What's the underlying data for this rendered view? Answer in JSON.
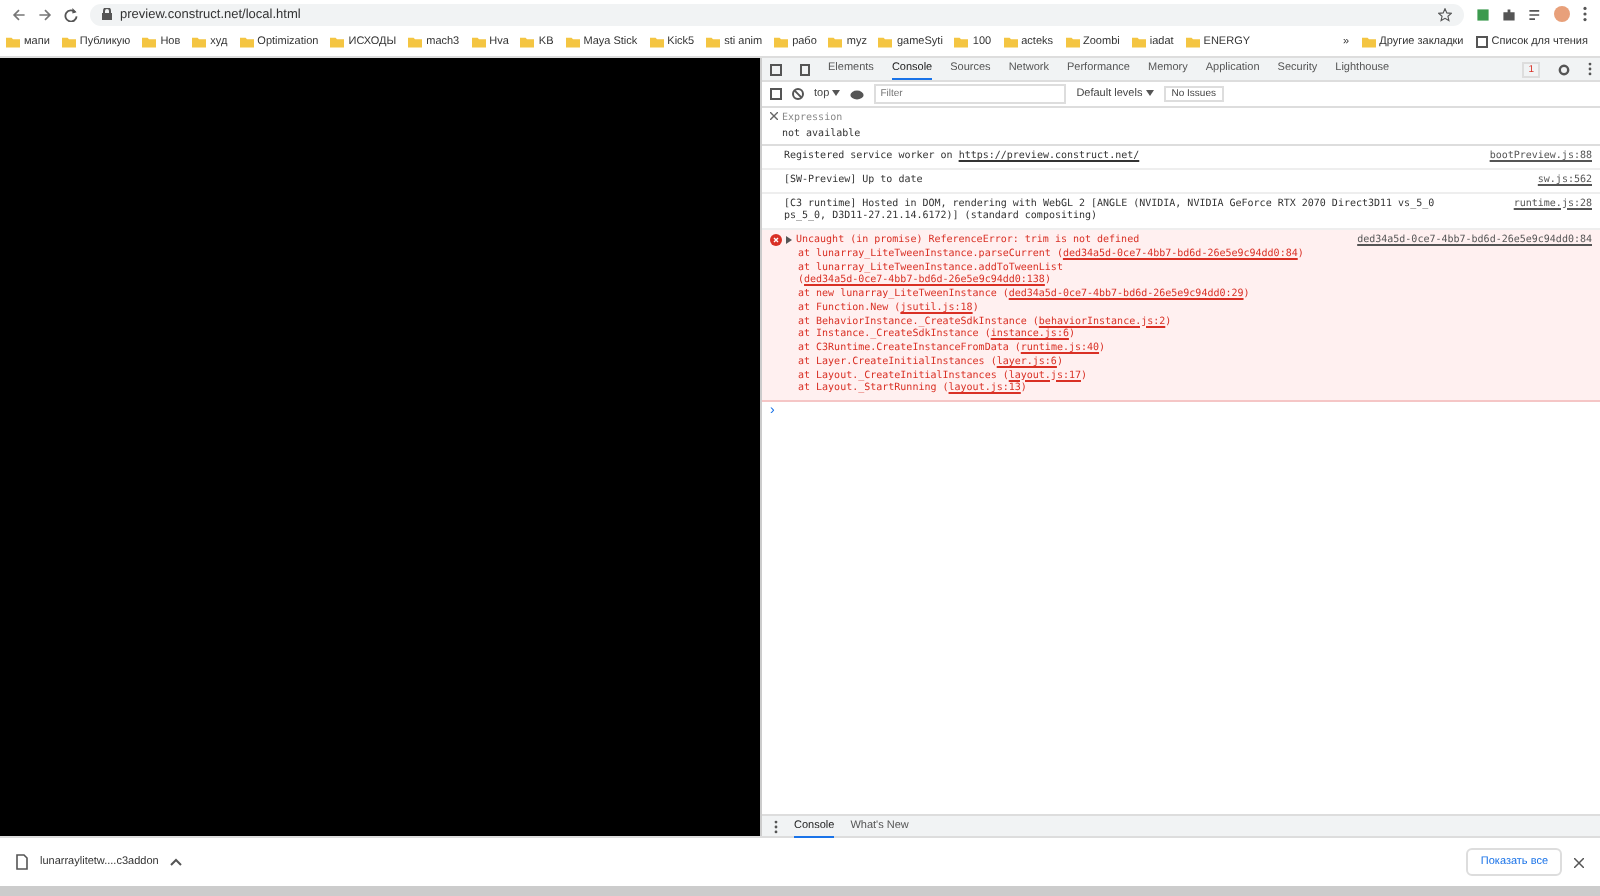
{
  "address_bar": {
    "url": "preview.construct.net/local.html"
  },
  "bookmarks": [
    "мапи",
    "Публикую",
    "Нов",
    "худ",
    "Optimization",
    "ИСХОДЫ",
    "mach3",
    "Hva",
    "KB",
    "Maya Stick",
    "Kick5",
    "sti anim",
    "рабо",
    "myz",
    "gameSyti",
    "100",
    "acteks",
    "Zoombi",
    "iadat",
    "ENERGY"
  ],
  "bookmarks_more": "»",
  "other_bookmarks": "Другие закладки",
  "reading_list": "Список для чтения",
  "devtools": {
    "tabs": [
      {
        "label": "Elements",
        "selected": false
      },
      {
        "label": "Console",
        "selected": true
      },
      {
        "label": "Sources",
        "selected": false
      },
      {
        "label": "Network",
        "selected": false
      },
      {
        "label": "Performance",
        "selected": false
      },
      {
        "label": "Memory",
        "selected": false
      },
      {
        "label": "Application",
        "selected": false
      },
      {
        "label": "Security",
        "selected": false
      },
      {
        "label": "Lighthouse",
        "selected": false
      }
    ],
    "error_count": "1",
    "context": "top",
    "filter_placeholder": "Filter",
    "levels": "Default levels",
    "issues": "No Issues",
    "expression": {
      "label": "Expression",
      "value": "not available"
    },
    "messages": [
      {
        "kind": "log",
        "parts": [
          {
            "text": "Registered service worker on "
          },
          {
            "text": "https://preview.construct.net/",
            "link": true
          }
        ],
        "source": "bootPreview.js:88"
      },
      {
        "kind": "log",
        "parts": [
          {
            "text": "[SW-Preview] Up to date"
          }
        ],
        "source": "sw.js:562"
      },
      {
        "kind": "log",
        "parts": [
          {
            "text": "[C3 runtime] Hosted in DOM, rendering with WebGL 2 [ANGLE (NVIDIA, NVIDIA GeForce RTX 2070 Direct3D11 vs_5_0 ps_5_0, D3D11-27.21.14.6172)] (standard compositing)"
          }
        ],
        "source": "runtime.js:28"
      },
      {
        "kind": "error",
        "parts": [
          {
            "text": "Uncaught (in promise) ReferenceError: trim is not defined"
          }
        ],
        "source": "ded34a5d-0ce7-4bb7-bd6d-26e5e9c94dd0:84",
        "stack": [
          {
            "text": "at lunarray_LiteTweenInstance.parseCurrent (",
            "link": "ded34a5d-0ce7-4bb7-bd6d-26e5e9c94dd0:84",
            "end": ")"
          },
          {
            "text": "at lunarray_LiteTweenInstance.addToTweenList (",
            "link": "ded34a5d-0ce7-4bb7-bd6d-26e5e9c94dd0:138",
            "end": ")"
          },
          {
            "text": "at new lunarray_LiteTweenInstance (",
            "link": "ded34a5d-0ce7-4bb7-bd6d-26e5e9c94dd0:29",
            "end": ")"
          },
          {
            "text": "at Function.New (",
            "link": "jsutil.js:18",
            "end": ")"
          },
          {
            "text": "at BehaviorInstance._CreateSdkInstance (",
            "link": "behaviorInstance.js:2",
            "end": ")"
          },
          {
            "text": "at Instance._CreateSdkInstance (",
            "link": "instance.js:6",
            "end": ")"
          },
          {
            "text": "at C3Runtime.CreateInstanceFromData (",
            "link": "runtime.js:40",
            "end": ")"
          },
          {
            "text": "at Layer.CreateInitialInstances (",
            "link": "layer.js:6",
            "end": ")"
          },
          {
            "text": "at Layout._CreateInitialInstances (",
            "link": "layout.js:17",
            "end": ")"
          },
          {
            "text": "at Layout._StartRunning (",
            "link": "layout.js:13",
            "end": ")"
          }
        ]
      }
    ],
    "prompt": "›",
    "drawer_tabs": [
      {
        "label": "Console",
        "selected": true
      },
      {
        "label": "What's New",
        "selected": false
      }
    ]
  },
  "download_bar": {
    "file": "lunarraylitetw....c3addon",
    "show_all": "Показать все"
  }
}
